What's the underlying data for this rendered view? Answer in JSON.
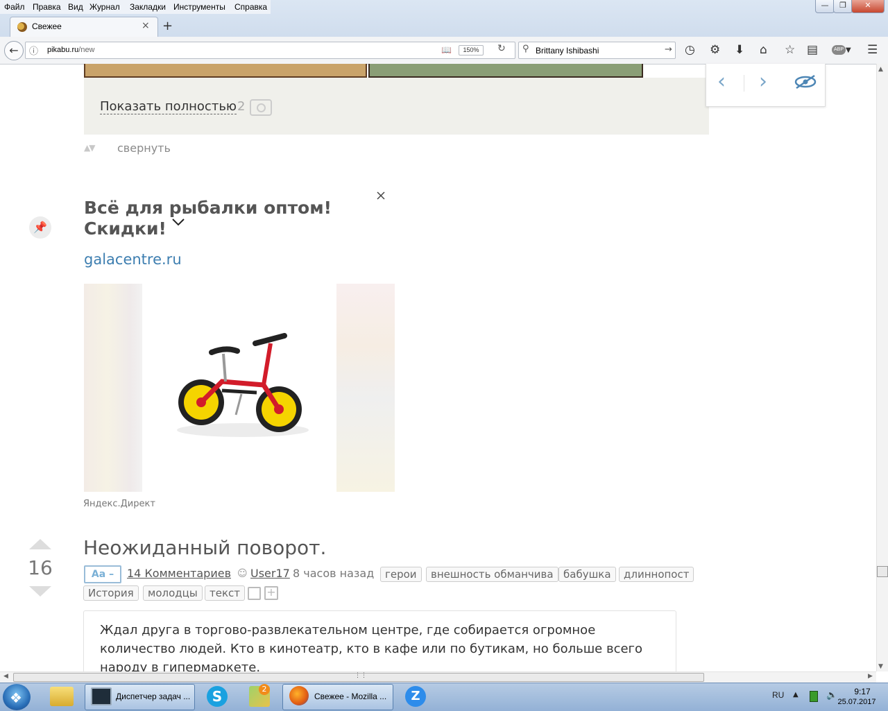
{
  "menu": {
    "items": [
      "Файл",
      "Правка",
      "Вид",
      "Журнал",
      "Закладки",
      "Инструменты",
      "Справка"
    ]
  },
  "window_controls": {
    "minimize": "—",
    "restore": "❐",
    "close": "✕"
  },
  "tab": {
    "title": "Свежее",
    "close": "×",
    "new_tab": "+"
  },
  "navbar": {
    "url_host": "pikabu.ru",
    "url_path": "/new",
    "zoom": "150%",
    "search_value": "Brittany Ishibashi",
    "abp_label": "ABP"
  },
  "page": {
    "story_footer": {
      "show_full": "Показать полностью",
      "photo_count": "2"
    },
    "collapse": {
      "label": "свернуть"
    },
    "ad": {
      "title_line1": "Всё для рыбалки оптом!",
      "title_line2": "Скидки!",
      "domain": "galacentre.ru",
      "provider": "Яндекс.Директ",
      "image_subject": "balance-bike"
    },
    "story": {
      "rating": "16",
      "title": "Неожиданный поворот.",
      "font_toggle": "Aa –",
      "comments": "14 Комментариев",
      "author": "User17",
      "time": "8 часов назад",
      "tags": [
        "герои",
        "внешность обманчива",
        "бабушка",
        "длиннопост",
        "История",
        "молодцы",
        "текст"
      ],
      "text": "Ждал друга в торгово-развлекательном центре, где собирается огромное количество людей. Кто в кинотеатр, кто в кафе или по бутикам, но больше всего народу в гипермаркете."
    }
  },
  "taskbar": {
    "tasks": [
      {
        "label": "Диспетчер задач ..."
      },
      {
        "label": "Свежее - Mozilla ..."
      }
    ],
    "maps_badge": "2",
    "tray": {
      "lang": "RU",
      "time": "9:17",
      "date": "25.07.2017"
    }
  },
  "colors": {
    "link_blue": "#3d7eb0",
    "chrome_bg": "#c7d6e9",
    "story_footer_bg": "#f0f0eb",
    "taskbar_bg": "#93b1d6"
  }
}
